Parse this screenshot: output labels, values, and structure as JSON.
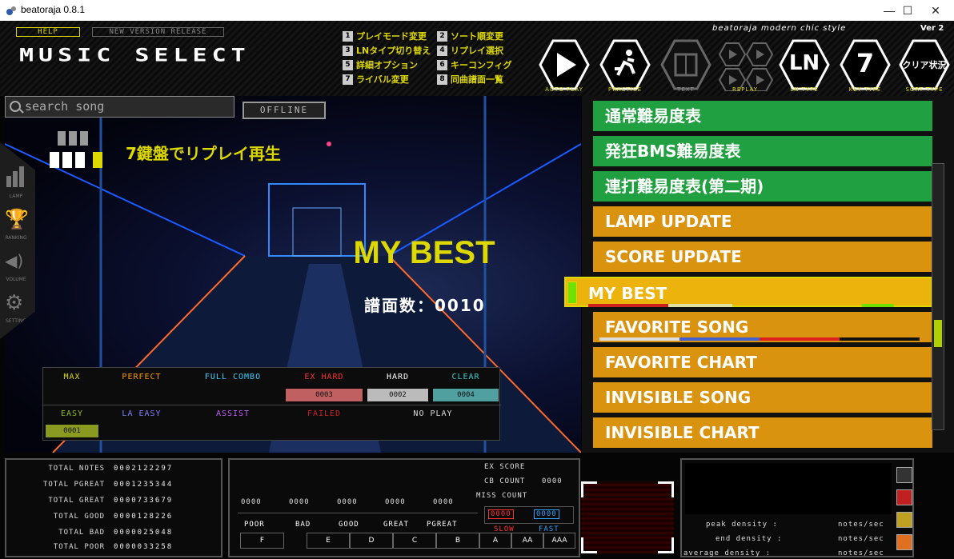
{
  "window": {
    "title": "beatoraja 0.8.1",
    "minimize": "—",
    "maximize": "☐",
    "close": "✕"
  },
  "header": {
    "help": "HELP",
    "new_version": "NEW VERSION RELEASE",
    "screen_title": "MUSIC SELECT",
    "brand": "beatoraja modern chic style",
    "version": "Ver 2"
  },
  "key_help": [
    {
      "key": "1",
      "label": "プレイモード変更"
    },
    {
      "key": "3",
      "label": "LNタイプ切り替え"
    },
    {
      "key": "5",
      "label": "詳細オプション"
    },
    {
      "key": "7",
      "label": "ライバル変更"
    },
    {
      "key": "2",
      "label": "ソート順変更"
    },
    {
      "key": "4",
      "label": "リプレイ選択"
    },
    {
      "key": "6",
      "label": "キーコンフィグ"
    },
    {
      "key": "8",
      "label": "同曲譜面一覧"
    }
  ],
  "top_buttons": [
    {
      "name": "auto-play",
      "label": "AUTO PLAY",
      "glyph": "▶"
    },
    {
      "name": "practice",
      "label": "PRACTICE",
      "glyph": "⛹"
    },
    {
      "name": "text",
      "label": "TEXT",
      "glyph": "☰"
    },
    {
      "name": "replay",
      "label": "REPLAY",
      "glyph": "▶"
    },
    {
      "name": "ln-type",
      "label": "LN TYPE",
      "glyph": "LN"
    },
    {
      "name": "key-type",
      "label": "KEY TYPE",
      "glyph": "7"
    },
    {
      "name": "sort-type",
      "label": "SORT TYPE",
      "glyph": "クリア状況"
    }
  ],
  "search": {
    "placeholder": "search song"
  },
  "offline": "OFFLINE",
  "side_menu": [
    {
      "name": "lamp",
      "label": "LAMP",
      "glyph": "▮▮▮"
    },
    {
      "name": "ranking",
      "label": "RANKING",
      "glyph": "🏆"
    },
    {
      "name": "volume",
      "label": "VOLUME",
      "glyph": "◀)"
    },
    {
      "name": "setting",
      "label": "SETTING",
      "glyph": "⚙"
    }
  ],
  "replay_text": "7鍵盤でリプレイ再生",
  "folder": {
    "title": "MY BEST",
    "count_label": "譜面数：",
    "count": "0010"
  },
  "lamp_table": {
    "row1": [
      "MAX",
      "PERFECT",
      "FULL COMBO",
      "EX HARD",
      "HARD",
      "CLEAR"
    ],
    "row1_values": [
      "",
      "",
      "",
      "0003",
      "0002",
      "0004"
    ],
    "row2": [
      "EASY",
      "LA EASY",
      "ASSIST",
      "FAILED",
      "NO PLAY"
    ],
    "row2_values": [
      "0001",
      "",
      "",
      "",
      ""
    ]
  },
  "song_list": [
    {
      "label": "通常難易度表",
      "color": "#20a040"
    },
    {
      "label": "発狂BMS難易度表",
      "color": "#20a040"
    },
    {
      "label": "連打難易度表(第二期)",
      "color": "#20a040"
    },
    {
      "label": "LAMP UPDATE",
      "color": "#d9930f"
    },
    {
      "label": "SCORE UPDATE",
      "color": "#d9930f"
    },
    {
      "label": "MY BEST",
      "color": "#d9930f",
      "selected": true
    },
    {
      "label": "FAVORITE SONG",
      "color": "#d9930f"
    },
    {
      "label": "FAVORITE CHART",
      "color": "#d9930f"
    },
    {
      "label": "INVISIBLE SONG",
      "color": "#d9930f"
    },
    {
      "label": "INVISIBLE CHART",
      "color": "#d9930f"
    }
  ],
  "totals": [
    {
      "label": "TOTAL NOTES",
      "value": "0002122297"
    },
    {
      "label": "TOTAL PGREAT",
      "value": "0001235344"
    },
    {
      "label": "TOTAL GREAT",
      "value": "0000733679"
    },
    {
      "label": "TOTAL GOOD",
      "value": "0000128226"
    },
    {
      "label": "TOTAL BAD",
      "value": "0000025048"
    },
    {
      "label": "TOTAL POOR",
      "value": "0000033258"
    }
  ],
  "score": {
    "ex_score": "EX SCORE",
    "cb_count": "CB COUNT",
    "cb_value": "0000",
    "miss_count": "MISS COUNT",
    "judge_values": [
      "0000",
      "0000",
      "0000",
      "0000",
      "0000"
    ],
    "judges": [
      "POOR",
      "BAD",
      "GOOD",
      "GREAT",
      "PGREAT"
    ],
    "slow_value": "0000",
    "fast_value": "0000",
    "slow": "SLOW",
    "fast": "FAST",
    "ranks": [
      "F",
      "E",
      "D",
      "C",
      "B",
      "A",
      "AA",
      "AAA"
    ]
  },
  "density": {
    "peak": "peak density :",
    "end": "end density :",
    "average": "average density :",
    "unit": "notes/sec"
  },
  "colors": {
    "accent": "#ddd800",
    "green": "#20a040",
    "orange": "#d9930f",
    "exhard": "#ff3030",
    "hard": "#ffffff",
    "clear": "#30d0d0",
    "easy": "#90c020",
    "laeasy": "#6060ff",
    "assist": "#c060ff",
    "failed": "#d02020"
  }
}
